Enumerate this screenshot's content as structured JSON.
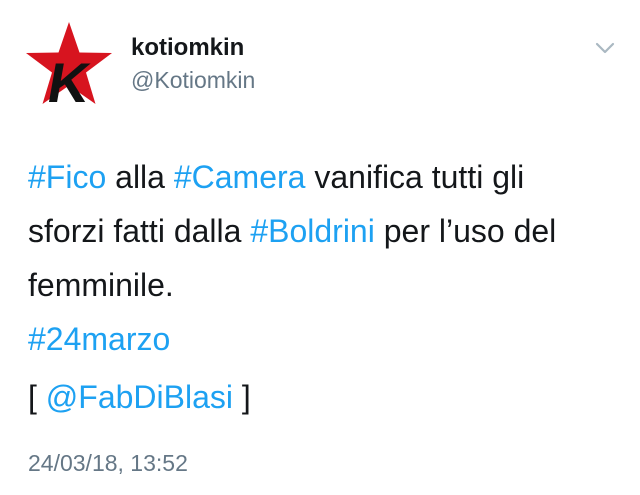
{
  "author": {
    "display_name": "kotiomkin",
    "handle": "@Kotiomkin",
    "avatar_letter": "K",
    "avatar_colors": {
      "star": "#d7141f",
      "letter": "#111111"
    }
  },
  "tweet": {
    "line1": {
      "hashtag1": "#Fico",
      "text1": " alla ",
      "hashtag2": "#Camera",
      "text2": " vanifica tutti gli"
    },
    "line2": {
      "text1": "sforzi fatti dalla ",
      "hashtag": "#Boldrini",
      "text2": " per l’uso del"
    },
    "line3": {
      "text": "femminile."
    },
    "line4": {
      "hashtag": "#24marzo"
    },
    "via": {
      "open": "[ ",
      "mention": "@FabDiBlasi",
      "close": " ]"
    },
    "timestamp": "24/03/18, 13:52"
  },
  "colors": {
    "link": "#1da1f2",
    "text": "#14171a",
    "secondary": "#657786"
  },
  "icons": {
    "menu": "chevron-down-icon"
  }
}
